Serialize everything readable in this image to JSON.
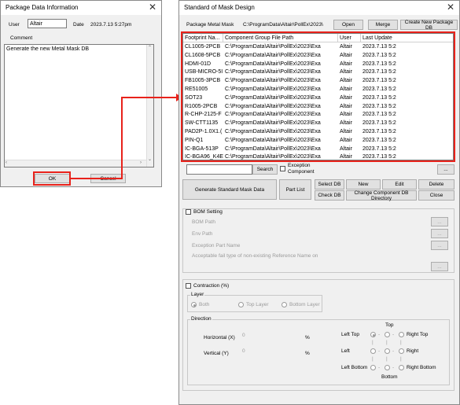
{
  "left": {
    "title": "Package Data Information",
    "user_label": "User",
    "user_value": "Altair",
    "date_label": "Date",
    "date_value": "2023.7.13 5:27pm",
    "comment_label": "Comment",
    "comment_text": "Generate the new Metal Mask DB",
    "ok_label": "OK",
    "cancel_label": "Cancel"
  },
  "right": {
    "title": "Standard of Mask Design",
    "package_label": "Package Metal Mask",
    "package_path": "C:\\ProgramData\\Altair\\PollEx\\2023\\",
    "open_label": "Open",
    "merge_label": "Merge",
    "create_label": "Create New Package DB",
    "table": {
      "headers": [
        "Footprint Na...",
        "Component Group File Path",
        "User",
        "Last Update"
      ],
      "rows": [
        [
          "CL1005-2PCB",
          "C:\\ProgramData\\Altair\\PollEx\\2023\\Exa",
          "Altair",
          "2023.7.13 5:2"
        ],
        [
          "CL1608-5PCB",
          "C:\\ProgramData\\Altair\\PollEx\\2023\\Exa",
          "Altair",
          "2023.7.13 5:2"
        ],
        [
          "HDMI-01D",
          "C:\\ProgramData\\Altair\\PollEx\\2023\\Exa",
          "Altair",
          "2023.7.13 5:2"
        ],
        [
          "USB-MICRO-5I",
          "C:\\ProgramData\\Altair\\PollEx\\2023\\Exa",
          "Altair",
          "2023.7.13 5:2"
        ],
        [
          "FB1005-3PCB",
          "C:\\ProgramData\\Altair\\PollEx\\2023\\Exa",
          "Altair",
          "2023.7.13 5:2"
        ],
        [
          "RE51005",
          "C:\\ProgramData\\Altair\\PollEx\\2023\\Exa",
          "Altair",
          "2023.7.13 5:2"
        ],
        [
          "SOT23",
          "C:\\ProgramData\\Altair\\PollEx\\2023\\Exa",
          "Altair",
          "2023.7.13 5:2"
        ],
        [
          "R1005-2PCB",
          "C:\\ProgramData\\Altair\\PollEx\\2023\\Exa",
          "Altair",
          "2023.7.13 5:2"
        ],
        [
          "R-CHP-2125-F",
          "C:\\ProgramData\\Altair\\PollEx\\2023\\Exa",
          "Altair",
          "2023.7.13 5:2"
        ],
        [
          "SW-CTT1135",
          "C:\\ProgramData\\Altair\\PollEx\\2023\\Exa",
          "Altair",
          "2023.7.13 5:2"
        ],
        [
          "PAD2P-1.0X1.(",
          "C:\\ProgramData\\Altair\\PollEx\\2023\\Exa",
          "Altair",
          "2023.7.13 5:2"
        ],
        [
          "PIN-Q1",
          "C:\\ProgramData\\Altair\\PollEx\\2023\\Exa",
          "Altair",
          "2023.7.13 5:2"
        ],
        [
          "IC-BGA-513P",
          "C:\\ProgramData\\Altair\\PollEx\\2023\\Exa",
          "Altair",
          "2023.7.13 5:2"
        ],
        [
          "IC-BGA96_K4E",
          "C:\\ProgramData\\Altair\\PollEx\\2023\\Exa",
          "Altair",
          "2023.7.13 5:2"
        ]
      ]
    },
    "search_label": "Search",
    "exception_label": "Exception Component",
    "ellipsis": "...",
    "generate_label": "Generate Standard Mask Data",
    "part_list_label": "Part List",
    "select_db_label": "Select DB",
    "check_db_label": "Check DB",
    "new_label": "New",
    "edit_label": "Edit",
    "delete_label": "Delete",
    "change_dir_label": "Change Component DB Directory",
    "close_label": "Close",
    "bom": {
      "title": "BOM Setting",
      "bom_path": "BOM Path",
      "env_path": "Env Path",
      "exception_part": "Exception Part Name",
      "acceptable": "Acceptable fail type of non-existing Reference Name on"
    },
    "contraction": {
      "title": "Contraction (%)",
      "layer_label": "Layer",
      "both": "Both",
      "top_layer": "Top Layer",
      "bottom_layer": "Bottom Layer",
      "direction_label": "Direction",
      "horizontal": "Horizontal (X)",
      "vertical": "Vertical (Y)",
      "h_value": "0",
      "v_value": "0",
      "percent": "%",
      "top": "Top",
      "left_top": "Left Top",
      "right_top": "Right Top",
      "left": "Left",
      "right": "Right",
      "left_bottom": "Left Bottom",
      "right_bottom": "Right Bottom",
      "bottom": "Bottom"
    }
  }
}
